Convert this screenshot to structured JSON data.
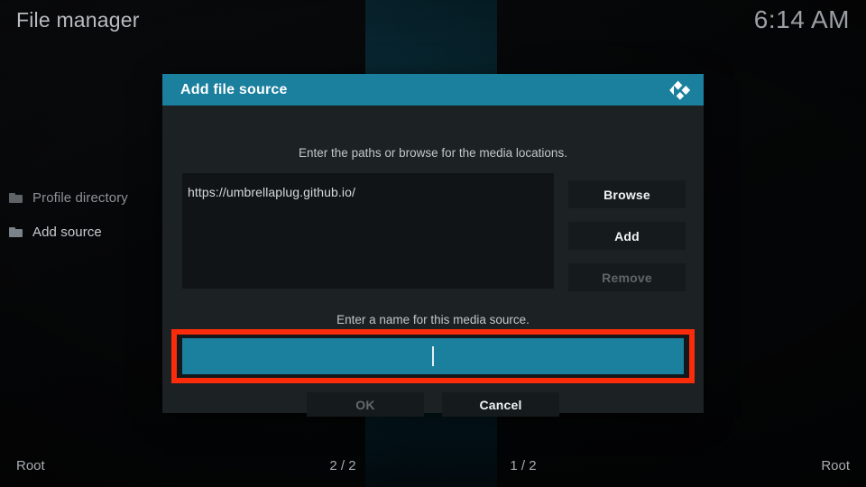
{
  "app": {
    "title": "File manager",
    "clock": "6:14 AM"
  },
  "filelist": {
    "items": [
      {
        "label": "Profile directory",
        "icon": "folder-icon"
      },
      {
        "label": "Add source",
        "icon": "folder-icon"
      }
    ]
  },
  "dialog": {
    "title": "Add file source",
    "logo_icon": "kodi-logo-icon",
    "hint_paths": "Enter the paths or browse for the media locations.",
    "path_value": "https://umbrellaplug.github.io/",
    "buttons": {
      "browse": "Browse",
      "add": "Add",
      "remove": "Remove"
    },
    "hint_name": "Enter a name for this media source.",
    "name_value": "",
    "footer_buttons": {
      "ok": "OK",
      "cancel": "Cancel"
    }
  },
  "footer": {
    "left": "Root",
    "count_left": "2 / 2",
    "count_right": "1 / 2",
    "right": "Root"
  },
  "colors": {
    "accent": "#1b7f9e",
    "highlight": "#fb2c0a",
    "dialog_bg": "#1c2124",
    "field_bg": "#101417"
  }
}
